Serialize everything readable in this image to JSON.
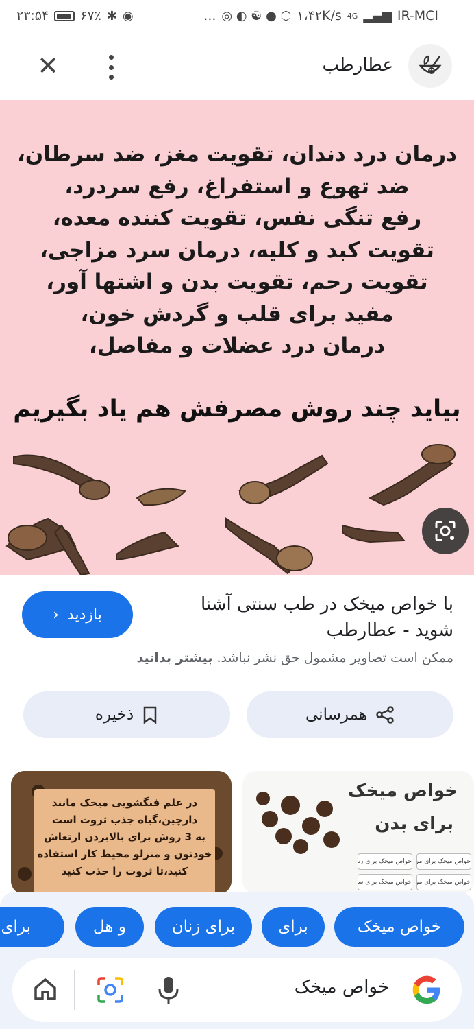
{
  "status_bar": {
    "time": "۲۳:۵۴",
    "battery": "۶۷٪",
    "speed": "۱،۴۲K/s",
    "network_type": "4G",
    "carrier": "IR-MCI",
    "more": "..."
  },
  "header": {
    "site_name": "عطارطب"
  },
  "hero": {
    "lines": [
      "درمان درد دندان، تقویت مغز، ضد سرطان،",
      "ضد تهوع و استفراغ، رفع سردرد،",
      "رفع تنگی نفس، تقویت کننده معده،",
      "تقویت کبد و کلیه، درمان سرد مزاجی،",
      "تقویت رحم، تقویت بدن و اشتها آور،",
      "مفید برای قلب و گردش خون،",
      "درمان درد عضلات و مفاصل،"
    ],
    "cta": "بیاید چند روش مصرفش هم یاد بگیریم"
  },
  "result": {
    "title": "با خواص میخک در طب سنتی آشنا شوید - عطارطب",
    "visit_label": "بازدید",
    "copyright_text": "ممکن است تصاویر مشمول حق نشر نباشد.",
    "learn_more": "بیشتر بدانید"
  },
  "actions": {
    "share_label": "همرسانی",
    "save_label": "ذخیره"
  },
  "thumbnails": {
    "left_note_lines": [
      "در علم فنگشویی میخک مانند",
      "دارچین،گیاه جذب ثروت است",
      "به 3 روش برای بالابردن ارتعاش",
      "خودتون و منزلو محیط کار استفاده",
      "کنید،تا ثروت را جذب کنید"
    ],
    "right_title": "خواص میخک",
    "right_subtitle": "برای بدن",
    "right_cells": [
      "خواص میخک برای مردان",
      "خواص میخک برای زنان",
      "خواص میخک برای مو و پوست",
      "خواص میخک برای سرماخوردگی"
    ]
  },
  "chips": [
    "خواص میخک",
    "برای",
    "برای زنان",
    "و هل",
    "برای مو"
  ],
  "search": {
    "query": "خواص میخک"
  },
  "colors": {
    "accent": "#1a73e8",
    "hero_bg": "#fbd0d5",
    "sheet_bg": "#eef2fa"
  }
}
